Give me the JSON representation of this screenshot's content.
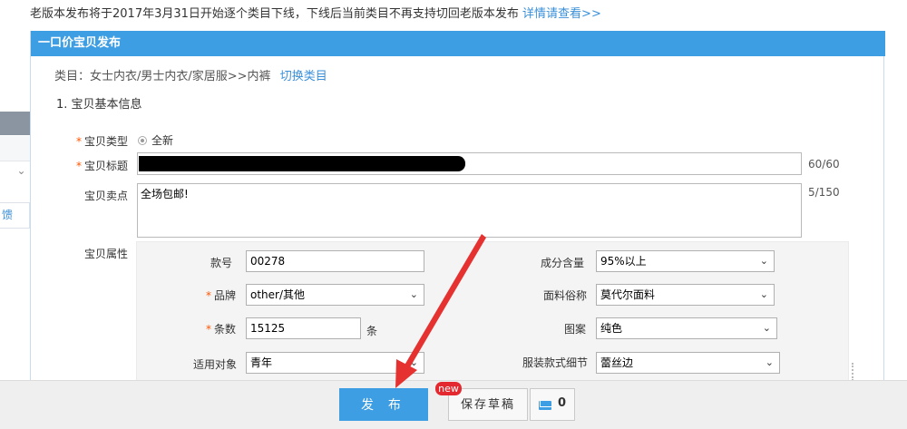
{
  "notice": {
    "text": "老版本发布将于2017年3月31日开始逐个类目下线，下线后当前类目不再支持切回老版本发布",
    "link": "详情请查看>>"
  },
  "left_panel": {
    "link_fragment": "馈"
  },
  "panel": {
    "title": "一口价宝贝发布",
    "category_text": "类目：女士内衣/男士内衣/家居服>>内裤",
    "switch_category": "切换类目",
    "section_title": "1. 宝贝基本信息"
  },
  "form": {
    "type": {
      "label": "宝贝类型",
      "required_mark": "*",
      "option": "全新"
    },
    "title": {
      "label": "宝贝标题",
      "required_mark": "*",
      "counter": "60/60"
    },
    "selling_point": {
      "label": "宝贝卖点",
      "value": "全场包邮!",
      "counter": "5/150"
    },
    "attributes": {
      "label": "宝贝属性",
      "style_no": {
        "label": "款号",
        "value": "00278"
      },
      "brand": {
        "label": "品牌",
        "required_mark": "*",
        "value": "other/其他"
      },
      "count": {
        "label": "条数",
        "required_mark": "*",
        "value": "15125",
        "unit": "条"
      },
      "target": {
        "label": "适用对象",
        "value": "青年"
      },
      "content": {
        "label": "成分含量",
        "value": "95%以上"
      },
      "fabric": {
        "label": "面料俗称",
        "value": "莫代尔面料"
      },
      "pattern": {
        "label": "图案",
        "value": "纯色"
      },
      "detail": {
        "label": "服装款式细节",
        "value": "蕾丝边"
      }
    }
  },
  "bottom": {
    "publish": "发 布",
    "save_draft": "保存草稿",
    "new_badge": "new",
    "draft_count": "0"
  },
  "colors": {
    "accent": "#3e9ee3",
    "required": "#ff5500",
    "badge": "#e4282f",
    "arrow": "#e5312f"
  }
}
